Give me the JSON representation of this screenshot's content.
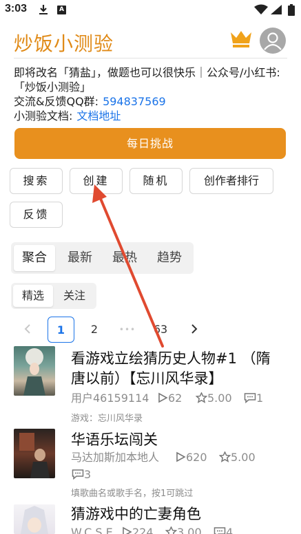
{
  "status_bar": {
    "time": "3:03",
    "a_icon": "A"
  },
  "header": {
    "title": "炒饭小测验"
  },
  "notice": {
    "text": "即将改名「猜盐」，做题也可以很快乐｜公众号/小红书:「炒饭小测验」",
    "qq_label": "交流&反馈QQ群:",
    "qq_value": "594837569",
    "doc_label": "小测验文档:",
    "doc_link": "文档地址"
  },
  "daily_button": "每日挑战",
  "tools": {
    "search": "搜索",
    "create": "创建",
    "random": "随机",
    "rank": "创作者排行",
    "feedback": "反馈"
  },
  "tabs": [
    "聚合",
    "最新",
    "最热",
    "趋势"
  ],
  "filters": [
    "精选",
    "关注"
  ],
  "pagination": {
    "current": "1",
    "next": "2",
    "ellipsis": "•••",
    "last": "63"
  },
  "items": [
    {
      "title": "看游戏立绘猜历史人物#1 （隋唐以前）【忘川风华录】",
      "author": "用户46159114",
      "plays": "62",
      "rating": "5.00",
      "comments": "1",
      "tag": "游戏：忘川风华录"
    },
    {
      "title": "华语乐坛闯关",
      "author": "马达加斯加本地人",
      "plays": "620",
      "rating": "5.00",
      "comments": "3",
      "tag": "填歌曲名或歌手名，按1可跳过"
    },
    {
      "title": "猜游戏中的亡妻角色",
      "author": "W.C.S.E",
      "plays": "224",
      "rating": "3.00",
      "comments": "4",
      "tag": ""
    }
  ],
  "colors": {
    "accent": "#e8901e",
    "link": "#1a73e8",
    "arrow": "#e04a30"
  }
}
